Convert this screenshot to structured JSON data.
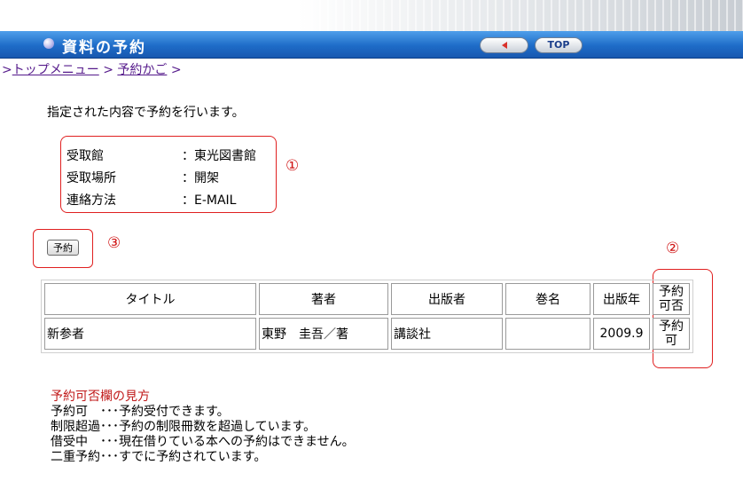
{
  "header": {
    "title": "資料の予約",
    "top_button": "TOP"
  },
  "breadcrumb": {
    "lead": ">",
    "items": [
      "トップメニュー",
      "予約かご"
    ],
    "sep": ">"
  },
  "intro": "指定された内容で予約を行います。",
  "info": [
    {
      "key": "受取館",
      "value": "：東光図書館"
    },
    {
      "key": "受取場所",
      "value": "：開架"
    },
    {
      "key": "連絡方法",
      "value": "：E-MAIL"
    }
  ],
  "markers": {
    "one": "①",
    "two": "②",
    "three": "③"
  },
  "reserve_button": "予約",
  "table": {
    "headers": [
      "タイトル",
      "著者",
      "出版者",
      "巻名",
      "出版年",
      "予約可否"
    ],
    "rows": [
      [
        "新参者",
        "東野　圭吾／著",
        "講談社",
        "",
        "2009.9",
        "予約可"
      ]
    ]
  },
  "legend": {
    "heading": "予約可否欄の見方",
    "lines": [
      "予約可　･･･予約受付できます。",
      "制限超過･･･予約の制限冊数を超過しています。",
      "借受中　･･･現在借りている本への予約はできません。",
      "二重予約･･･すでに予約されています。"
    ]
  },
  "colors": {
    "title_bar": "#1e6cc8",
    "annotation_red": "#e02020",
    "link": "#551a8b"
  }
}
